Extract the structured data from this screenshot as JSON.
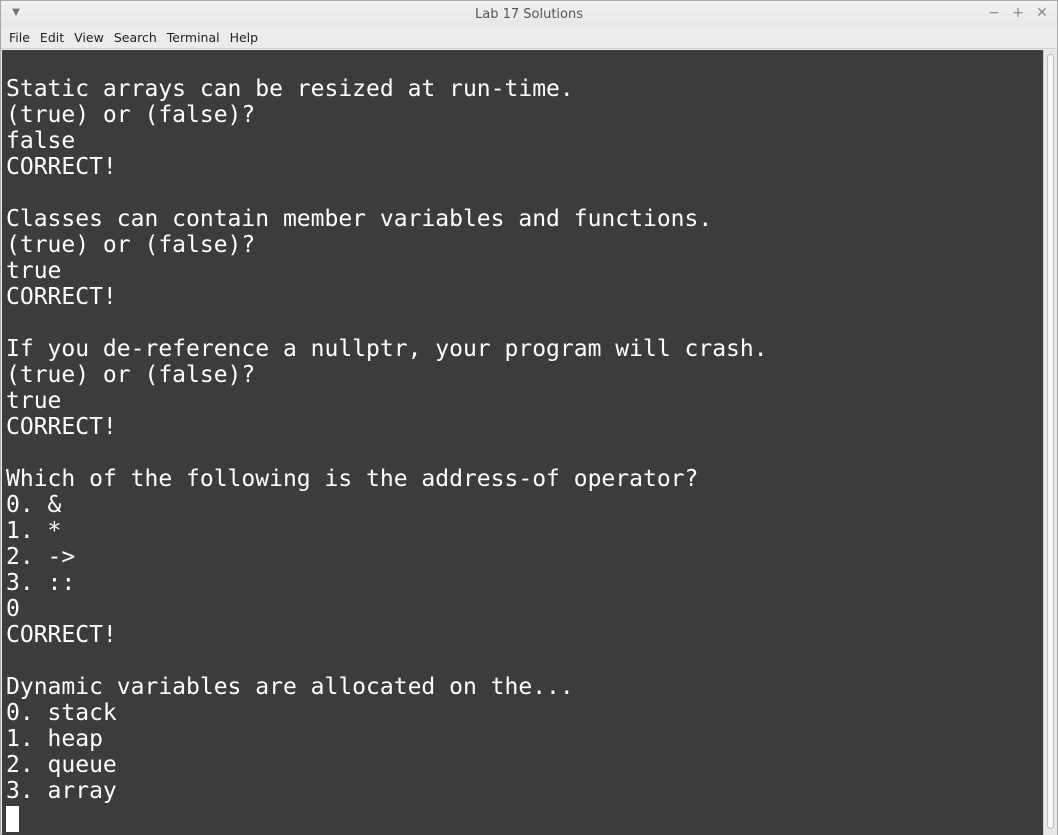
{
  "window": {
    "title": "Lab 17 Solutions",
    "menu_icon": "chevron-down-icon",
    "minimize_glyph": "−",
    "maximize_glyph": "+",
    "close_glyph": "✕"
  },
  "menubar": {
    "items": [
      "File",
      "Edit",
      "View",
      "Search",
      "Terminal",
      "Help"
    ]
  },
  "terminal": {
    "background": "#3c3c3c",
    "foreground": "#ffffff",
    "lines": [
      "",
      "Static arrays can be resized at run-time.",
      "(true) or (false)?",
      "false",
      "CORRECT!",
      "",
      "Classes can contain member variables and functions.",
      "(true) or (false)?",
      "true",
      "CORRECT!",
      "",
      "If you de-reference a nullptr, your program will crash.",
      "(true) or (false)?",
      "true",
      "CORRECT!",
      "",
      "Which of the following is the address-of operator?",
      "0. &",
      "1. *",
      "2. ->",
      "3. ::",
      "0",
      "CORRECT!",
      "",
      "Dynamic variables are allocated on the...",
      "0. stack",
      "1. heap",
      "2. queue",
      "3. array"
    ]
  }
}
